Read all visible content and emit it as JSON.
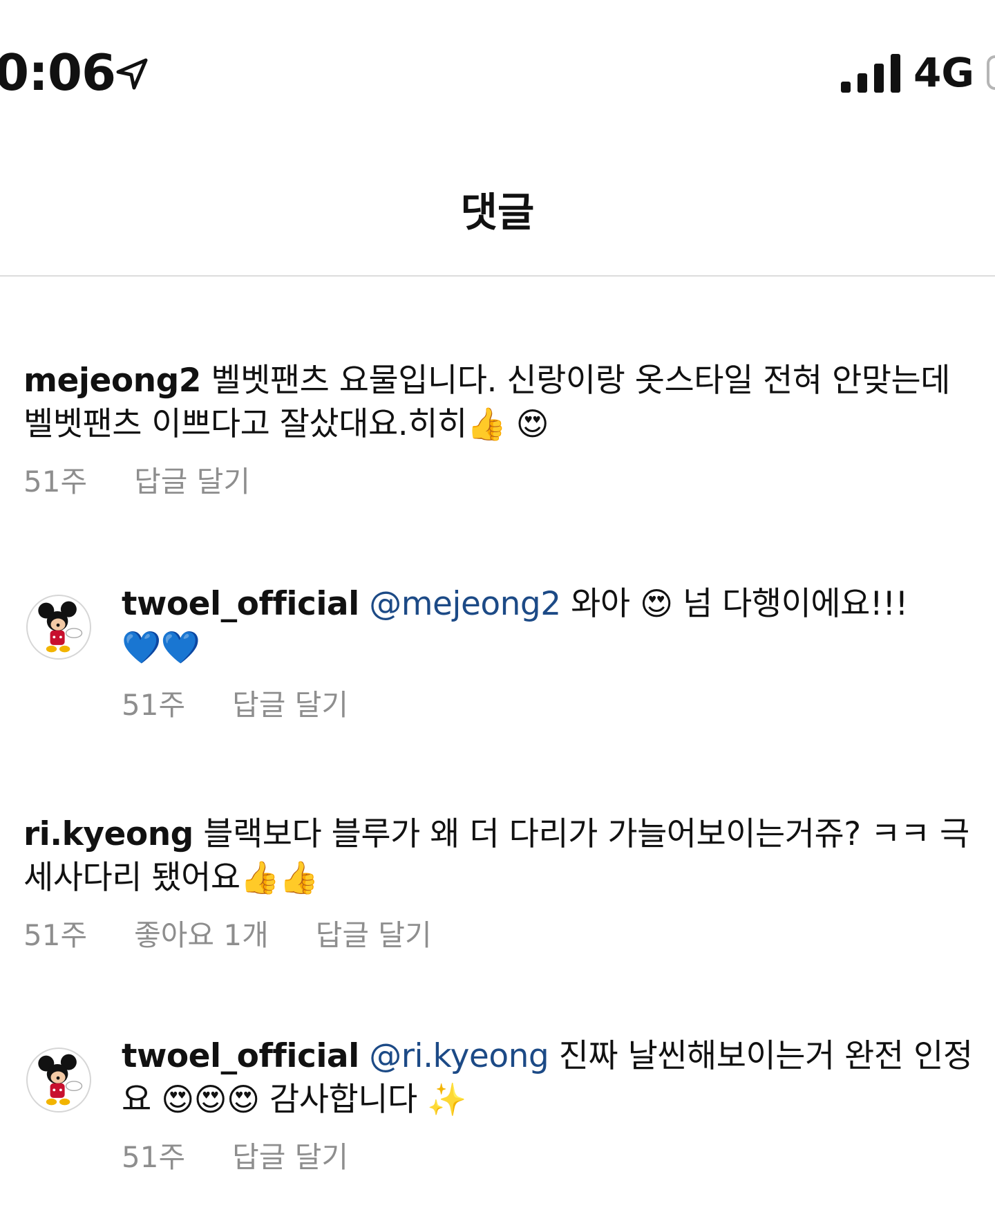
{
  "status_bar": {
    "time": "0:06",
    "network": "4G"
  },
  "header": {
    "title": "댓글"
  },
  "comments": [
    {
      "username": "mejeong2",
      "text": " 벨벳팬츠 요물입니다. 신랑이랑 옷스타일 전혀 안맞는데 벨벳팬츠 이쁘다고 잘샀대요.히히",
      "emoji": "👍 😍",
      "time": "51주",
      "reply_label": "답글 달기"
    },
    {
      "username": "twoel_official",
      "mention": "@mejeong2",
      "text_before_emoji": " 와아 ",
      "emoji_mid": "😍",
      "text_after_emoji": " 넘 다행이에요!!!",
      "emoji": "💙💙",
      "time": "51주",
      "reply_label": "답글 달기"
    },
    {
      "username": "ri.kyeong",
      "text": " 블랙보다 블루가 왜 더 다리가 가늘어보이는거쥬? ㅋㅋ 극세사다리 됐어요",
      "emoji": "👍👍",
      "time": "51주",
      "likes": "좋아요 1개",
      "reply_label": "답글 달기"
    },
    {
      "username": "twoel_official",
      "mention": "@ri.kyeong",
      "text": " 진짜 날씬해보이는거 완전 인정요 ",
      "emoji_mid": "😍😍😍",
      "text_after_emoji": " 감사합니다 ",
      "emoji": "✨",
      "time": "51주",
      "reply_label": "답글 달기"
    }
  ]
}
